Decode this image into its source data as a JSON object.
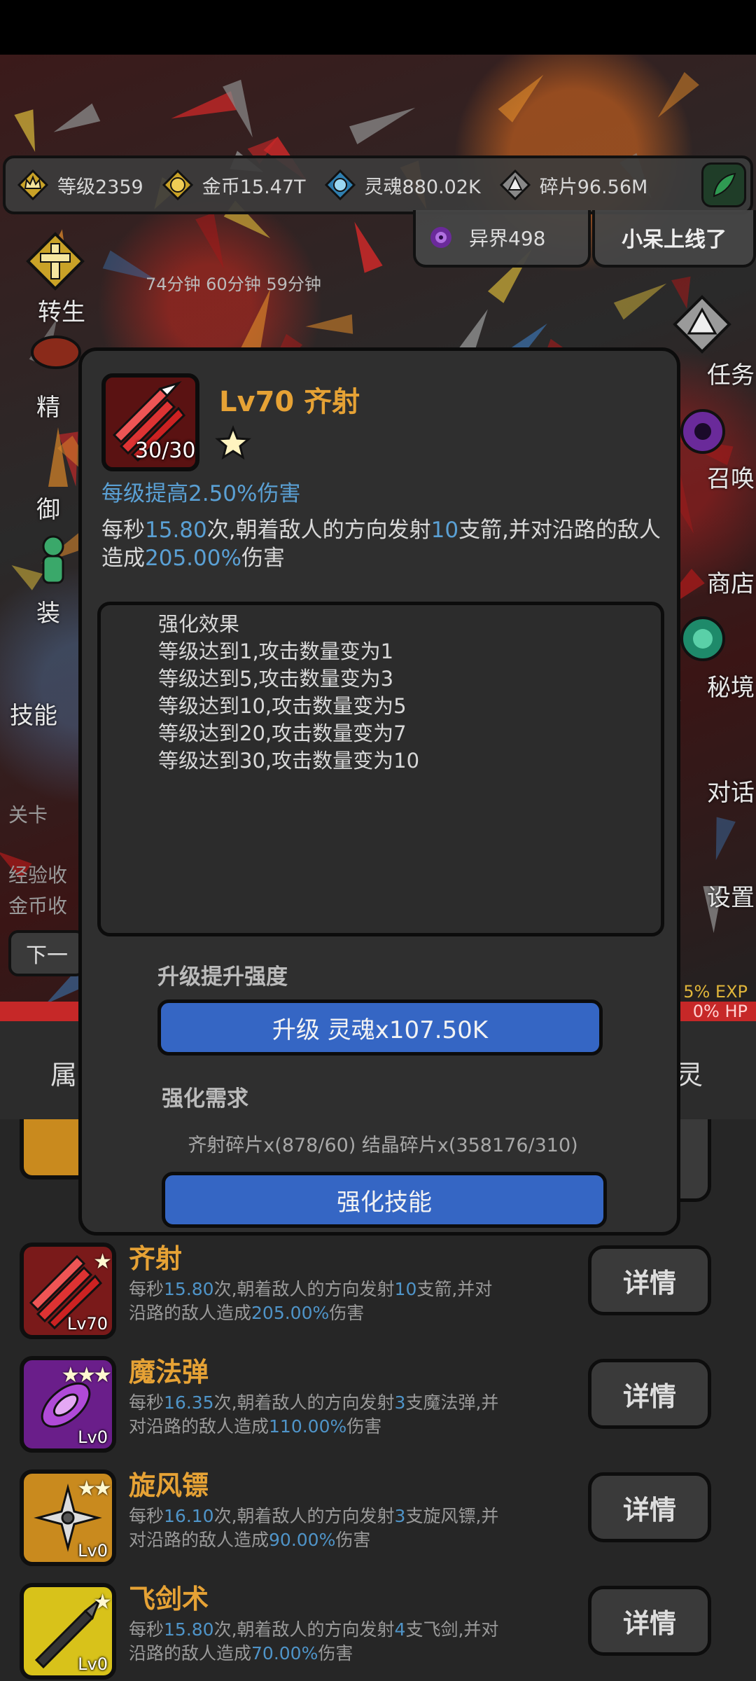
{
  "resources": [
    {
      "icon": "crown-icon",
      "label": "等级2359"
    },
    {
      "icon": "coin-icon",
      "label": "金币15.47T"
    },
    {
      "icon": "soul-icon",
      "label": "灵魂880.02K"
    },
    {
      "icon": "shard-icon",
      "label": "碎片96.56M"
    }
  ],
  "realm": {
    "label": "异界498"
  },
  "online_tab": {
    "label": "小呆上线了"
  },
  "timers": "74分钟  60分钟  59分钟",
  "left_side": [
    "转生",
    "精",
    "御",
    "装",
    "技能"
  ],
  "right_side": [
    "任务",
    "召唤",
    "商店",
    "秘境",
    "对话",
    "设置"
  ],
  "left_info": [
    "关卡",
    "经验收",
    "金币收"
  ],
  "next_button": "下一",
  "bars": {
    "exp": "5% EXP",
    "hp": "0% HP"
  },
  "bottom_tabs": {
    "left": "属",
    "right": "灵"
  },
  "modal": {
    "title": "Lv70 齐射",
    "count": "30/30",
    "per_level": "每级提高2.50%伤害",
    "desc_parts": [
      "每秒",
      "15.80",
      "次,朝着敌人的方向发射",
      "10",
      "支箭,并对沿路的敌人造成",
      "205.00%",
      "伤害"
    ],
    "effects_title": "强化效果",
    "effects": [
      "等级达到1,攻击数量变为1",
      "等级达到5,攻击数量变为3",
      "等级达到10,攻击数量变为5",
      "等级达到20,攻击数量变为7",
      "等级达到30,攻击数量变为10"
    ],
    "upgrade_label": "升级提升强度",
    "upgrade_button": "升级 灵魂x107.50K",
    "require_label": "强化需求",
    "require_text": "齐射碎片x(878/60) 结晶碎片x(358176/310)",
    "enhance_button": "强化技能"
  },
  "skills": [
    {
      "name": "齐射",
      "level": "Lv70",
      "stars": "★",
      "color": "#7a1a1a",
      "desc": [
        "每秒",
        "15.80",
        "次,朝着敌人的方向发射",
        "10",
        "支箭,并对沿路的敌人造成",
        "205.00%",
        "伤害"
      ],
      "button": "详情"
    },
    {
      "name": "魔法弹",
      "level": "Lv0",
      "stars": "★★★",
      "color": "#6a1e8a",
      "desc": [
        "每秒",
        "16.35",
        "次,朝着敌人的方向发射",
        "3",
        "支魔法弹,并对沿路的敌人造成",
        "110.00%",
        "伤害"
      ],
      "button": "详情"
    },
    {
      "name": "旋风镖",
      "level": "Lv0",
      "stars": "★★",
      "color": "#c98a1e",
      "desc": [
        "每秒",
        "16.10",
        "次,朝着敌人的方向发射",
        "3",
        "支旋风镖,并对沿路的敌人造成",
        "90.00%",
        "伤害"
      ],
      "button": "详情"
    },
    {
      "name": "飞剑术",
      "level": "Lv0",
      "stars": "★",
      "color": "#d8c21a",
      "desc": [
        "每秒",
        "15.80",
        "次,朝着敌人的方向发射",
        "4",
        "支飞剑,并对沿路的敌人造成",
        "70.00%",
        "伤害"
      ],
      "button": "详情"
    }
  ]
}
